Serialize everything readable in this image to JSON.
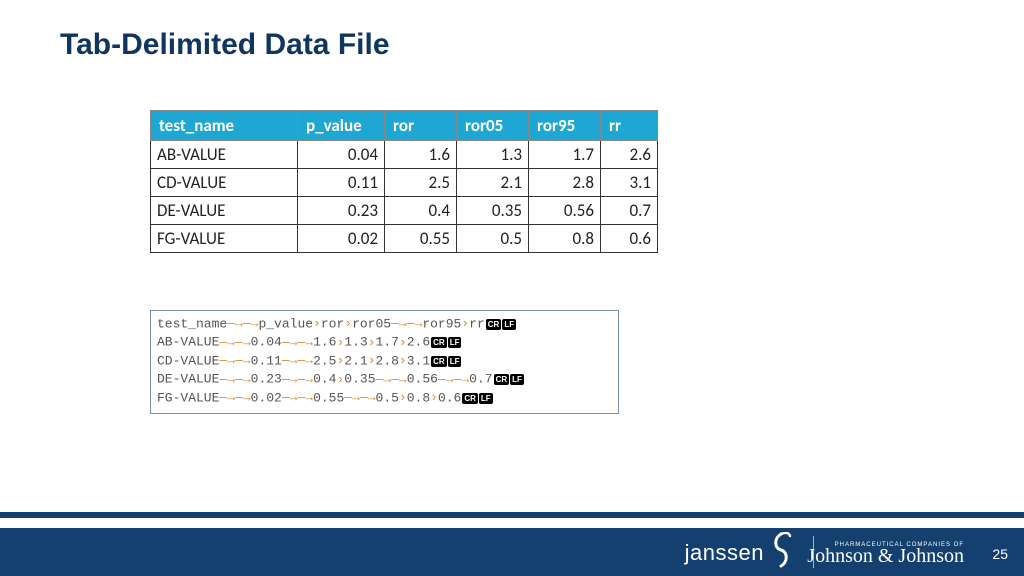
{
  "title": "Tab-Delimited Data File",
  "table": {
    "headers": [
      "test_name",
      "p_value",
      "ror",
      "ror05",
      "ror95",
      "rr"
    ],
    "rows": [
      {
        "name": "AB-VALUE",
        "p": "0.04",
        "ror": "1.6",
        "r05": "1.3",
        "r95": "1.7",
        "rr": "2.6"
      },
      {
        "name": "CD-VALUE",
        "p": "0.11",
        "ror": "2.5",
        "r05": "2.1",
        "r95": "2.8",
        "rr": "3.1"
      },
      {
        "name": "DE-VALUE",
        "p": "0.23",
        "ror": "0.4",
        "r05": "0.35",
        "r95": "0.56",
        "rr": "0.7"
      },
      {
        "name": "FG-VALUE",
        "p": "0.02",
        "ror": "0.55",
        "r05": "0.5",
        "r95": "0.8",
        "rr": "0.6"
      }
    ]
  },
  "raw": {
    "lines": [
      {
        "fields": [
          "test_name",
          "p_value",
          "ror",
          "ror05",
          "ror95",
          "rr"
        ],
        "tabs": [
          2,
          1,
          1,
          2,
          1
        ]
      },
      {
        "fields": [
          "AB-VALUE",
          "0.04",
          "1.6",
          "1.3",
          "1.7",
          "2.6"
        ],
        "tabs": [
          2,
          2,
          1,
          1,
          1
        ]
      },
      {
        "fields": [
          "CD-VALUE",
          "0.11",
          "2.5",
          "2.1",
          "2.8",
          "3.1"
        ],
        "tabs": [
          2,
          2,
          1,
          1,
          1
        ]
      },
      {
        "fields": [
          "DE-VALUE",
          "0.23",
          "0.4",
          "0.35",
          "0.56",
          "0.7"
        ],
        "tabs": [
          2,
          2,
          1,
          2,
          2
        ]
      },
      {
        "fields": [
          "FG-VALUE",
          "0.02",
          "0.55",
          "0.5",
          "0.8",
          "0.6"
        ],
        "tabs": [
          2,
          2,
          2,
          1,
          1
        ]
      }
    ],
    "cr": "CR",
    "lf": "LF"
  },
  "footer": {
    "page": "25",
    "logo1": "janssen",
    "logo2_tag": "PHARMACEUTICAL COMPANIES OF",
    "logo2": "Johnson & Johnson"
  },
  "chart_data": {
    "type": "table",
    "title": "Tab-Delimited Data File",
    "columns": [
      "test_name",
      "p_value",
      "ror",
      "ror05",
      "ror95",
      "rr"
    ],
    "rows": [
      [
        "AB-VALUE",
        0.04,
        1.6,
        1.3,
        1.7,
        2.6
      ],
      [
        "CD-VALUE",
        0.11,
        2.5,
        2.1,
        2.8,
        3.1
      ],
      [
        "DE-VALUE",
        0.23,
        0.4,
        0.35,
        0.56,
        0.7
      ],
      [
        "FG-VALUE",
        0.02,
        0.55,
        0.5,
        0.8,
        0.6
      ]
    ]
  }
}
